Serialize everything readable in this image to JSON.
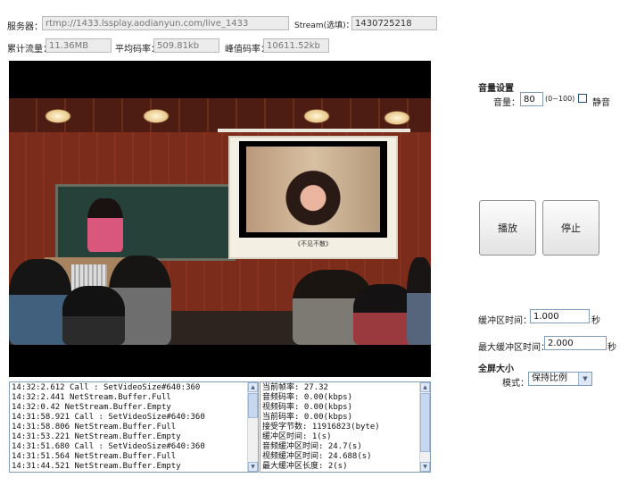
{
  "server": {
    "label": "服务器：",
    "value": "rtmp://1433.lssplay.aodianyun.com/live_1433"
  },
  "stream": {
    "label": "Stream(选填)：",
    "value": "1430725218"
  },
  "stats": {
    "total_label": "累计流量：",
    "total_value": "11.36MB",
    "avg_label": "平均码率：",
    "avg_value": "509.81kb",
    "peak_label": "峰值码率：",
    "peak_value": "10611.52kb"
  },
  "video": {
    "caption": "《不见不散》"
  },
  "volume": {
    "title": "音量设置",
    "label": "音量：",
    "value": "80",
    "range": "(0~100)",
    "mute_label": "静音",
    "muted": false
  },
  "buttons": {
    "play": "播放",
    "stop": "停止"
  },
  "buffer": {
    "time_label": "缓冲区时间：",
    "time_value": "1.000",
    "unit": "秒",
    "max_label": "最大缓冲区时间：",
    "max_value": "2.000"
  },
  "fullscreen": {
    "title": "全屏大小",
    "mode_label": "模式：",
    "mode_value": "保持比例"
  },
  "log_left": [
    "14:32:2.612 Call : SetVideoSize#640:360",
    "14:32:2.441 NetStream.Buffer.Full",
    "14:32:0.42 NetStream.Buffer.Empty",
    "14:31:58.921 Call : SetVideoSize#640:360",
    "14:31:58.806 NetStream.Buffer.Full",
    "14:31:53.221 NetStream.Buffer.Empty",
    "14:31:51.680 Call : SetVideoSize#640:360",
    "14:31:51.564 NetStream.Buffer.Full",
    "14:31:44.521 NetStream.Buffer.Empty"
  ],
  "log_right": [
    "当前帧率: 27.32",
    "音频码率: 0.00(kbps)",
    "视频码率: 0.00(kbps)",
    "当前码率: 0.00(kbps)",
    "接受字节数: 11916823(byte)",
    "缓冲区时间: 1(s)",
    "音频缓冲区时间: 24.7(s)",
    "视频缓冲区时间: 24.688(s)",
    "最大缓冲区长度: 2(s)"
  ]
}
